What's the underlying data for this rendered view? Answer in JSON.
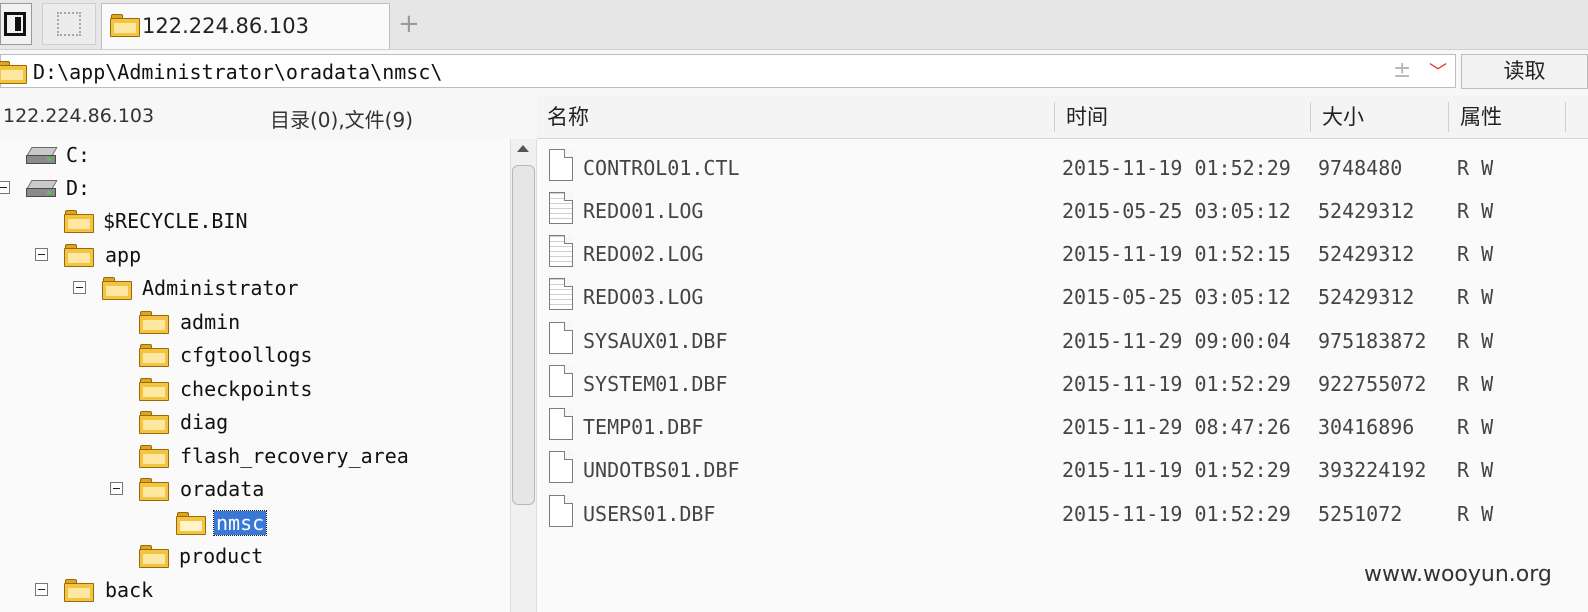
{
  "tabs": [
    {
      "label": "122.224.86.103",
      "icon": "folder-icon"
    }
  ],
  "tab_add_label": "+",
  "path": {
    "value": "D:\\app\\Administrator\\oradata\\nmsc\\",
    "plus_symbol": "±",
    "dropdown_symbol": "﹀"
  },
  "read_button": "读取",
  "left_header": {
    "host": "122.224.86.103",
    "counts": "目录(0),文件(9)"
  },
  "columns": {
    "name": "名称",
    "time": "时间",
    "size": "大小",
    "attr": "属性"
  },
  "tree": [
    {
      "label": "C:",
      "icon": "drive-icon",
      "depth": 0,
      "expanded": false
    },
    {
      "label": "D:",
      "icon": "drive-icon",
      "depth": 0,
      "expanded": true
    },
    {
      "label": "$RECYCLE.BIN",
      "icon": "folder-icon",
      "depth": 1,
      "expanded": false
    },
    {
      "label": "app",
      "icon": "folder-icon",
      "depth": 1,
      "expanded": true
    },
    {
      "label": "Administrator",
      "icon": "folder-icon",
      "depth": 2,
      "expanded": true
    },
    {
      "label": "admin",
      "icon": "folder-icon",
      "depth": 3,
      "expanded": false
    },
    {
      "label": "cfgtoollogs",
      "icon": "folder-icon",
      "depth": 3,
      "expanded": false
    },
    {
      "label": "checkpoints",
      "icon": "folder-icon",
      "depth": 3,
      "expanded": false
    },
    {
      "label": "diag",
      "icon": "folder-icon",
      "depth": 3,
      "expanded": false
    },
    {
      "label": "flash_recovery_area",
      "icon": "folder-icon",
      "depth": 3,
      "expanded": false
    },
    {
      "label": "oradata",
      "icon": "folder-icon",
      "depth": 3,
      "expanded": true
    },
    {
      "label": "nmsc",
      "icon": "folder-open-icon",
      "depth": 4,
      "expanded": false,
      "selected": true
    },
    {
      "label": "product",
      "icon": "folder-icon",
      "depth": 3,
      "expanded": false
    },
    {
      "label": "back",
      "icon": "folder-icon",
      "depth": 1,
      "expanded": true
    }
  ],
  "files": [
    {
      "name": "CONTROL01.CTL",
      "time": "2015-11-19 01:52:29",
      "size": "9748480",
      "attr": "R W",
      "icon": "file-icon"
    },
    {
      "name": "REDO01.LOG",
      "time": "2015-05-25 03:05:12",
      "size": "52429312",
      "attr": "R W",
      "icon": "text-file-icon"
    },
    {
      "name": "REDO02.LOG",
      "time": "2015-11-19 01:52:15",
      "size": "52429312",
      "attr": "R W",
      "icon": "text-file-icon"
    },
    {
      "name": "REDO03.LOG",
      "time": "2015-05-25 03:05:12",
      "size": "52429312",
      "attr": "R W",
      "icon": "text-file-icon"
    },
    {
      "name": "SYSAUX01.DBF",
      "time": "2015-11-29 09:00:04",
      "size": "975183872",
      "attr": "R W",
      "icon": "file-icon"
    },
    {
      "name": "SYSTEM01.DBF",
      "time": "2015-11-19 01:52:29",
      "size": "922755072",
      "attr": "R W",
      "icon": "file-icon"
    },
    {
      "name": "TEMP01.DBF",
      "time": "2015-11-29 08:47:26",
      "size": "30416896",
      "attr": "R W",
      "icon": "file-icon"
    },
    {
      "name": "UNDOTBS01.DBF",
      "time": "2015-11-19 01:52:29",
      "size": "393224192",
      "attr": "R W",
      "icon": "file-icon"
    },
    {
      "name": "USERS01.DBF",
      "time": "2015-11-19 01:52:29",
      "size": "5251072",
      "attr": "R W",
      "icon": "file-icon"
    }
  ],
  "watermark": "www.wooyun.org",
  "colors": {
    "selection": "#3a78d8",
    "folder": "#f3c441",
    "dropdown": "#e03030"
  }
}
